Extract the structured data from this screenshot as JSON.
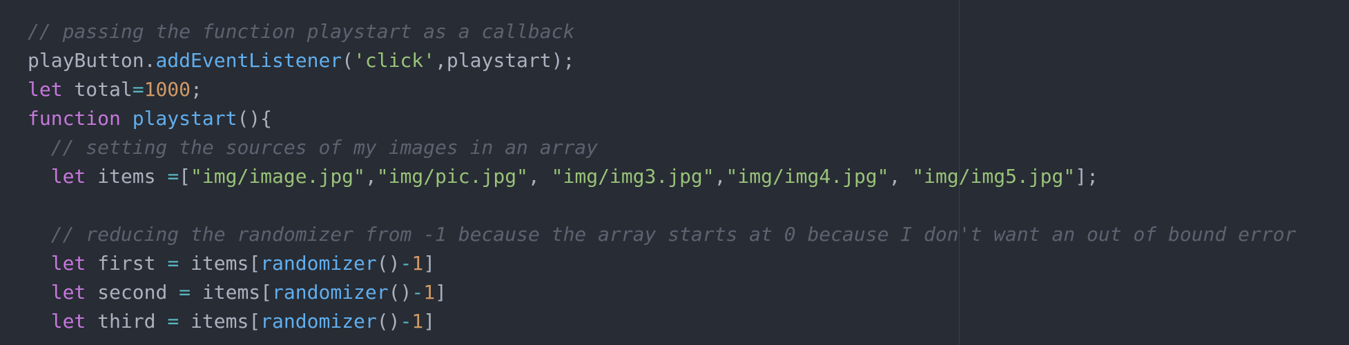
{
  "editor": {
    "theme_colors": {
      "background": "#282c34",
      "comment": "#5c6370",
      "keyword": "#c678dd",
      "function": "#61afef",
      "string": "#98c379",
      "number": "#d19a66",
      "operator": "#56b6c2",
      "plain": "#abb2bf"
    },
    "lines": [
      [
        {
          "t": "comment",
          "v": "// passing the function playstart as a callback"
        }
      ],
      [
        {
          "t": "plain",
          "v": "playButton."
        },
        {
          "t": "function",
          "v": "addEventListener"
        },
        {
          "t": "plain",
          "v": "("
        },
        {
          "t": "string",
          "v": "'click'"
        },
        {
          "t": "plain",
          "v": ",playstart);"
        }
      ],
      [
        {
          "t": "keyword",
          "v": "let"
        },
        {
          "t": "plain",
          "v": " total"
        },
        {
          "t": "operator",
          "v": "="
        },
        {
          "t": "number",
          "v": "1000"
        },
        {
          "t": "plain",
          "v": ";"
        }
      ],
      [
        {
          "t": "keyword",
          "v": "function"
        },
        {
          "t": "plain",
          "v": " "
        },
        {
          "t": "function",
          "v": "playstart"
        },
        {
          "t": "plain",
          "v": "(){"
        }
      ],
      [
        {
          "t": "plain",
          "v": "  "
        },
        {
          "t": "comment",
          "v": "// setting the sources of my images in an array"
        }
      ],
      [
        {
          "t": "plain",
          "v": "  "
        },
        {
          "t": "keyword",
          "v": "let"
        },
        {
          "t": "plain",
          "v": " items "
        },
        {
          "t": "operator",
          "v": "="
        },
        {
          "t": "plain",
          "v": "["
        },
        {
          "t": "string",
          "v": "\"img/image.jpg\""
        },
        {
          "t": "plain",
          "v": ","
        },
        {
          "t": "string",
          "v": "\"img/pic.jpg\""
        },
        {
          "t": "plain",
          "v": ", "
        },
        {
          "t": "string",
          "v": "\"img/img3.jpg\""
        },
        {
          "t": "plain",
          "v": ","
        },
        {
          "t": "string",
          "v": "\"img/img4.jpg\""
        },
        {
          "t": "plain",
          "v": ", "
        },
        {
          "t": "string",
          "v": "\"img/img5.jpg\""
        },
        {
          "t": "plain",
          "v": "];"
        }
      ],
      [],
      [
        {
          "t": "plain",
          "v": "  "
        },
        {
          "t": "comment",
          "v": "// reducing the randomizer from -1 because the array starts at 0 because I don't want an out of bound error"
        }
      ],
      [
        {
          "t": "plain",
          "v": "  "
        },
        {
          "t": "keyword",
          "v": "let"
        },
        {
          "t": "plain",
          "v": " first "
        },
        {
          "t": "operator",
          "v": "="
        },
        {
          "t": "plain",
          "v": " items["
        },
        {
          "t": "function",
          "v": "randomizer"
        },
        {
          "t": "plain",
          "v": "()"
        },
        {
          "t": "operator",
          "v": "-"
        },
        {
          "t": "number",
          "v": "1"
        },
        {
          "t": "plain",
          "v": "]"
        }
      ],
      [
        {
          "t": "plain",
          "v": "  "
        },
        {
          "t": "keyword",
          "v": "let"
        },
        {
          "t": "plain",
          "v": " second "
        },
        {
          "t": "operator",
          "v": "="
        },
        {
          "t": "plain",
          "v": " items["
        },
        {
          "t": "function",
          "v": "randomizer"
        },
        {
          "t": "plain",
          "v": "()"
        },
        {
          "t": "operator",
          "v": "-"
        },
        {
          "t": "number",
          "v": "1"
        },
        {
          "t": "plain",
          "v": "]"
        }
      ],
      [
        {
          "t": "plain",
          "v": "  "
        },
        {
          "t": "keyword",
          "v": "let"
        },
        {
          "t": "plain",
          "v": " third "
        },
        {
          "t": "operator",
          "v": "="
        },
        {
          "t": "plain",
          "v": " items["
        },
        {
          "t": "function",
          "v": "randomizer"
        },
        {
          "t": "plain",
          "v": "()"
        },
        {
          "t": "operator",
          "v": "-"
        },
        {
          "t": "number",
          "v": "1"
        },
        {
          "t": "plain",
          "v": "]"
        }
      ]
    ]
  }
}
